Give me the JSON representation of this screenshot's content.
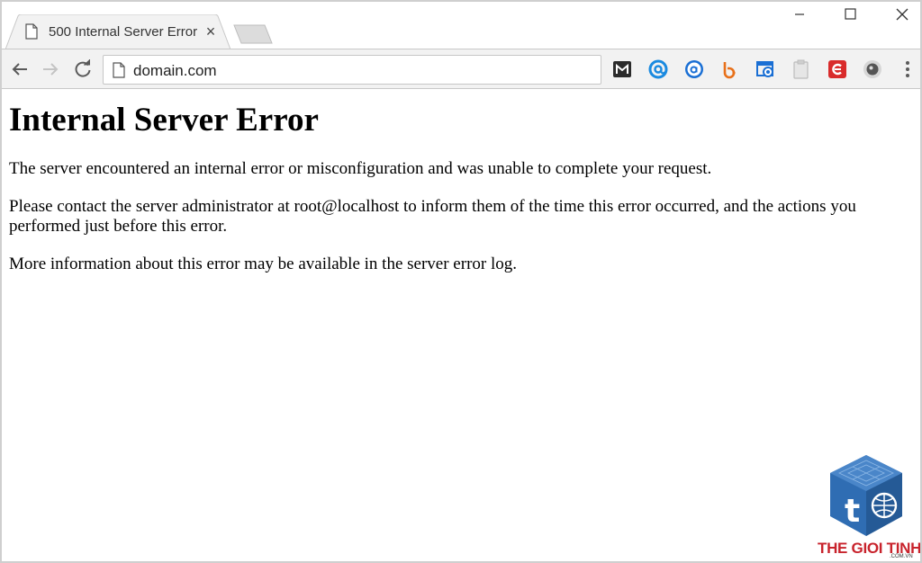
{
  "browser": {
    "tab": {
      "title": "500 Internal Server Error",
      "close_glyph": "×"
    },
    "address_bar": {
      "url": "domain.com"
    },
    "extensions": [
      {
        "name": "m-extension-icon",
        "color": "#2b2b2b"
      },
      {
        "name": "at-sign-extension-icon",
        "color": "#1a8ae0"
      },
      {
        "name": "a-circle-extension-icon",
        "color": "#1a6fd4"
      },
      {
        "name": "b-extension-icon",
        "color": "#e8701a"
      },
      {
        "name": "screenshot-extension-icon",
        "color": "#1a6fd4"
      },
      {
        "name": "clipboard-extension-icon",
        "color": "#bcbcbc"
      },
      {
        "name": "c-extension-icon",
        "color": "#d92b2b"
      },
      {
        "name": "circle-extension-icon",
        "color": "#555555"
      }
    ]
  },
  "page": {
    "heading": "Internal Server Error",
    "paragraphs": [
      "The server encountered an internal error or misconfiguration and was unable to complete your request.",
      "Please contact the server administrator at root@localhost to inform them of the time this error occurred, and the actions you performed just before this error.",
      "More information about this error may be available in the server error log."
    ]
  },
  "watermark": {
    "brand": "THE GIOI TINHOC",
    "domain": ".COM.VN",
    "colors": {
      "cube": "#2f6db3",
      "text": "#c8232c"
    }
  }
}
